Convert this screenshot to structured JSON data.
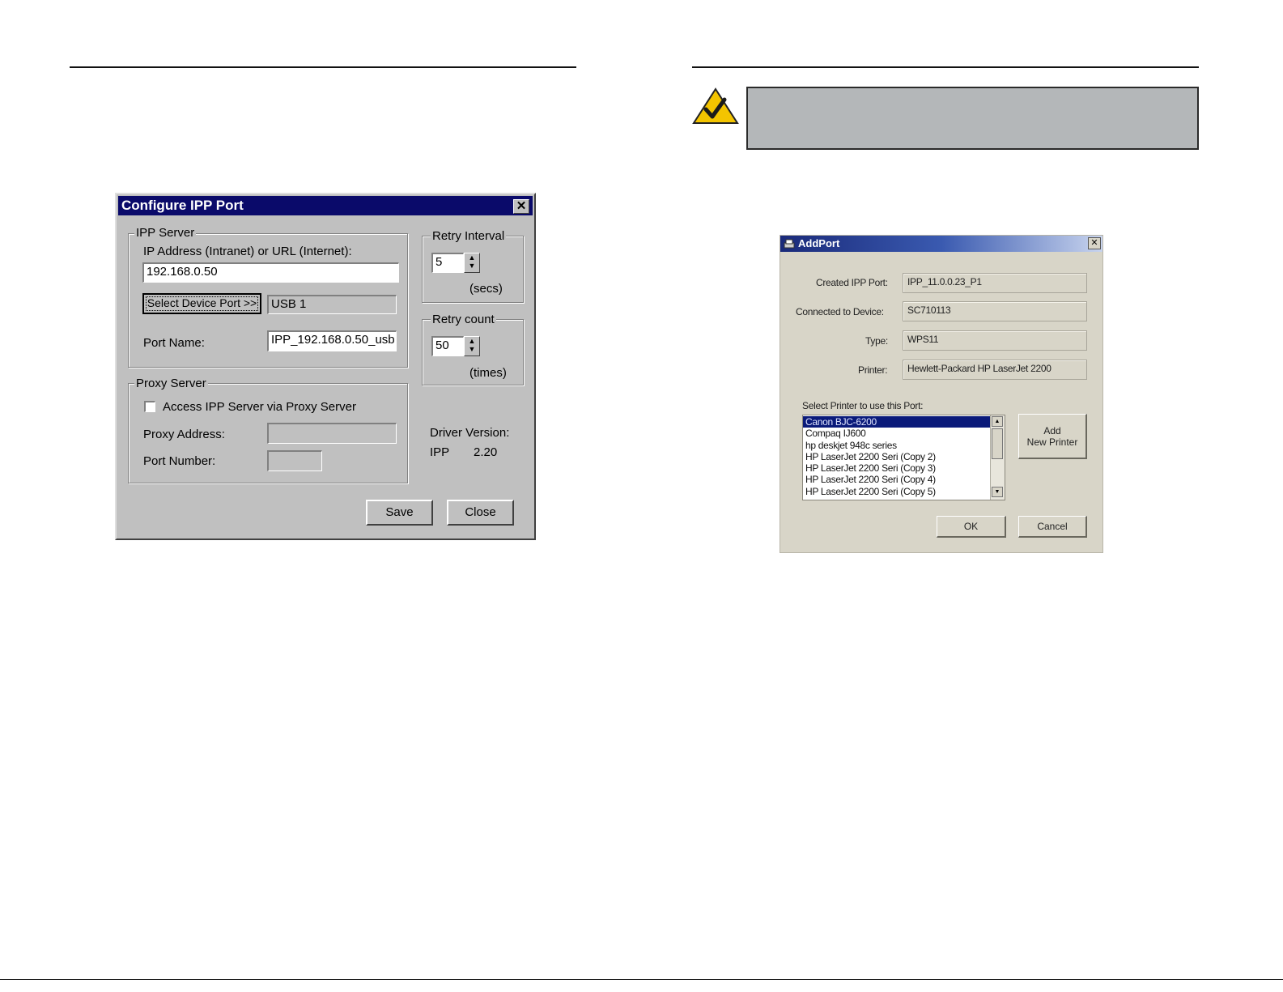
{
  "left_page": {
    "dialog": {
      "title": "Configure IPP Port",
      "close_glyph": "✕",
      "ipp_server": {
        "group_label": "IPP Server",
        "address_label": "IP Address (Intranet) or URL (Internet):",
        "address_value": "192.168.0.50",
        "select_device_button": "Select Device Port >>",
        "device_port_value": "USB 1",
        "port_name_label": "Port Name:",
        "port_name_value": "IPP_192.168.0.50_usb"
      },
      "retry_interval": {
        "group_label": "Retry Interval",
        "value": "5",
        "unit": "(secs)"
      },
      "retry_count": {
        "group_label": "Retry count",
        "value": "50",
        "unit": "(times)"
      },
      "proxy_server": {
        "group_label": "Proxy Server",
        "checkbox_label": "Access IPP Server via Proxy Server",
        "checkbox_checked": false,
        "proxy_address_label": "Proxy Address:",
        "proxy_address_value": "",
        "port_number_label": "Port Number:",
        "port_number_value": ""
      },
      "driver_version": {
        "label": "Driver Version:",
        "name": "IPP",
        "version": "2.20"
      },
      "save_button": "Save",
      "close_button": "Close"
    }
  },
  "right_page": {
    "note_icon": "checkmark-note-icon",
    "dialog": {
      "title": "AddPort",
      "close_glyph": "✕",
      "created_ipp_port_label": "Created IPP Port:",
      "created_ipp_port_value": "IPP_11.0.0.23_P1",
      "connected_device_label": "Connected to Device:",
      "connected_device_value": "SC710113",
      "type_label": "Type:",
      "type_value": "WPS11",
      "printer_label": "Printer:",
      "printer_value": "Hewlett-Packard HP LaserJet 2200",
      "select_printer_label": "Select Printer to use this Port:",
      "printers": [
        "Canon BJC-6200",
        "Compaq IJ600",
        "hp deskjet 948c series",
        "HP LaserJet 2200 Seri (Copy 2)",
        "HP LaserJet 2200 Seri (Copy 3)",
        "HP LaserJet 2200 Seri (Copy 4)",
        "HP LaserJet 2200 Seri (Copy 5)"
      ],
      "selected_printer": "Canon BJC-6200",
      "add_printer_line1": "Add",
      "add_printer_line2": "New Printer",
      "ok_button": "OK",
      "cancel_button": "Cancel"
    }
  }
}
